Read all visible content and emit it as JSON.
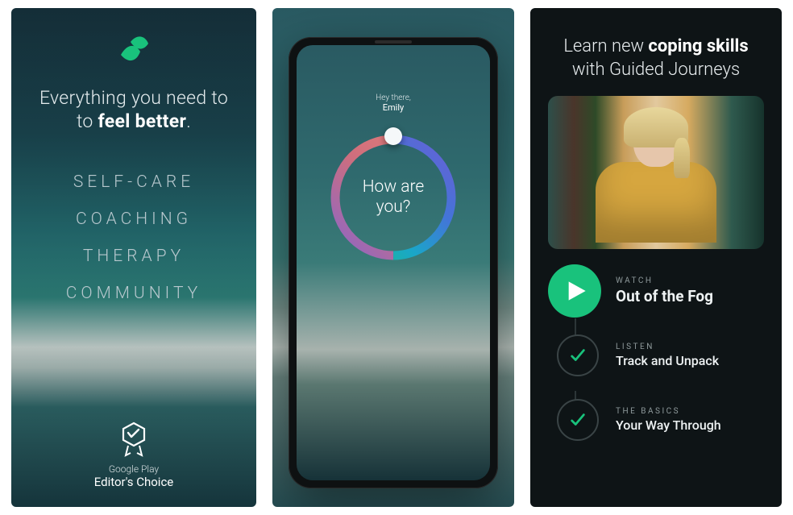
{
  "panel1": {
    "tagline_lead": "Everything you need to ",
    "tagline_bold": "feel better",
    "tagline_tail": ".",
    "features": [
      "SELF-CARE",
      "COACHING",
      "THERAPY",
      "COMMUNITY"
    ],
    "badge_sub": "Google Play",
    "badge_main": "Editor's Choice"
  },
  "panel2": {
    "greeting_small": "Hey there,",
    "greeting_name": "Emily",
    "mood_question_l1": "How are",
    "mood_question_l2": "you?"
  },
  "panel3": {
    "title_lead": "Learn new ",
    "title_bold": "coping skills",
    "title_line2": "with Guided Journeys",
    "journeys": [
      {
        "label": "WATCH",
        "title": "Out of the Fog"
      },
      {
        "label": "LISTEN",
        "title": "Track and Unpack"
      },
      {
        "label": "THE BASICS",
        "title": "Your Way Through"
      }
    ]
  },
  "colors": {
    "accent": "#19c27c"
  }
}
